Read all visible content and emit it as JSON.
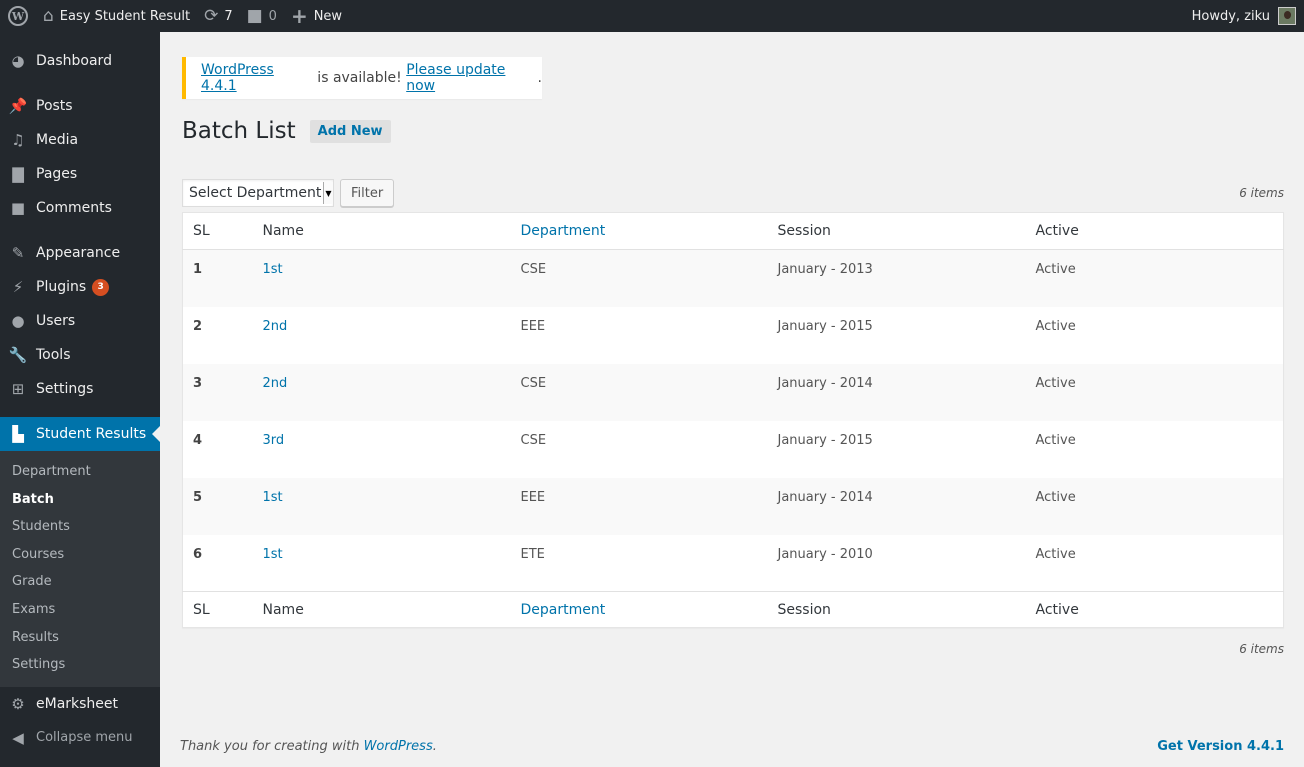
{
  "admin_bar": {
    "site_name": "Easy Student Result",
    "updates_count": "7",
    "comments_count": "0",
    "new_label": "New",
    "greeting": "Howdy, ziku"
  },
  "sidebar": {
    "items": [
      {
        "label": "Dashboard",
        "icon": "dashboard-icon"
      },
      {
        "label": "Posts",
        "icon": "pin-icon"
      },
      {
        "label": "Media",
        "icon": "media-icon"
      },
      {
        "label": "Pages",
        "icon": "pages-icon"
      },
      {
        "label": "Comments",
        "icon": "comment-icon"
      },
      {
        "label": "Appearance",
        "icon": "brush-icon"
      },
      {
        "label": "Plugins",
        "icon": "plugin-icon",
        "badge": "3"
      },
      {
        "label": "Users",
        "icon": "user-icon"
      },
      {
        "label": "Tools",
        "icon": "wrench-icon"
      },
      {
        "label": "Settings",
        "icon": "settings-icon"
      },
      {
        "label": "Student Results",
        "icon": "book-icon"
      }
    ],
    "submenu": [
      "Department",
      "Batch",
      "Students",
      "Courses",
      "Grade",
      "Exams",
      "Results",
      "Settings"
    ],
    "active_submenu": "Batch",
    "emarksheet": "eMarksheet",
    "collapse": "Collapse menu"
  },
  "notice": {
    "link1": "WordPress 4.4.1",
    "middle": " is available! ",
    "link2": "Please update now",
    "end": "."
  },
  "page": {
    "title": "Batch List",
    "add_new": "Add New"
  },
  "filter": {
    "select_value": "Select Department",
    "button": "Filter",
    "items_count": "6 items"
  },
  "table": {
    "columns": [
      "SL",
      "Name",
      "Department",
      "Session",
      "Active"
    ],
    "rows": [
      {
        "sl": "1",
        "name": "1st",
        "department": "CSE",
        "session": "January - 2013",
        "active": "Active"
      },
      {
        "sl": "2",
        "name": "2nd",
        "department": "EEE",
        "session": "January - 2015",
        "active": "Active"
      },
      {
        "sl": "3",
        "name": "2nd",
        "department": "CSE",
        "session": "January - 2014",
        "active": "Active"
      },
      {
        "sl": "4",
        "name": "3rd",
        "department": "CSE",
        "session": "January - 2015",
        "active": "Active"
      },
      {
        "sl": "5",
        "name": "1st",
        "department": "EEE",
        "session": "January - 2014",
        "active": "Active"
      },
      {
        "sl": "6",
        "name": "1st",
        "department": "ETE",
        "session": "January - 2010",
        "active": "Active"
      }
    ]
  },
  "footer": {
    "thanks": "Thank you for creating with ",
    "wp_link": "WordPress",
    "thanks_end": ".",
    "version_link": "Get Version 4.4.1"
  },
  "colors": {
    "accent": "#0073aa",
    "notice": "#ffb900",
    "badge": "#d54e21",
    "sidebar": "#23282d"
  }
}
